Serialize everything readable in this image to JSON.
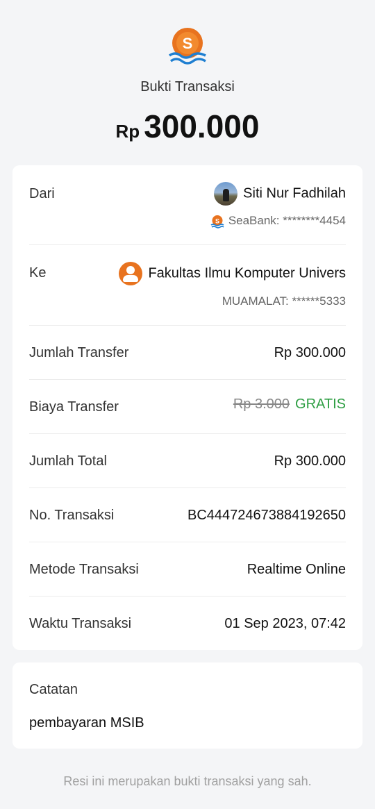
{
  "header": {
    "title": "Bukti Transaksi",
    "currency": "Rp",
    "amount": "300.000"
  },
  "sender": {
    "label": "Dari",
    "name": "Siti Nur Fadhilah",
    "account": "SeaBank: ********4454"
  },
  "recipient": {
    "label": "Ke",
    "name": "Fakultas Ilmu Komputer Univers",
    "account": "MUAMALAT: ******5333"
  },
  "details": [
    {
      "label": "Jumlah Transfer",
      "value": "Rp 300.000"
    },
    {
      "label": "Biaya Transfer",
      "original": "Rp 3.000",
      "value": "GRATIS"
    },
    {
      "label": "Jumlah Total",
      "value": "Rp 300.000"
    },
    {
      "label": "No. Transaksi",
      "value": "BC444724673884192650"
    },
    {
      "label": "Metode Transaksi",
      "value": "Realtime Online"
    },
    {
      "label": "Waktu Transaksi",
      "value": "01 Sep 2023, 07:42"
    }
  ],
  "note": {
    "label": "Catatan",
    "text": "pembayaran MSIB"
  },
  "footer": "Resi ini merupakan bukti transaksi yang sah.",
  "colors": {
    "brand": "#e8731f",
    "accent_blue": "#1f7fd1",
    "free": "#2e9e43"
  },
  "icons": {
    "logo": "seabank-logo",
    "sender_avatar": "profile-photo",
    "recipient_avatar": "user-icon"
  }
}
